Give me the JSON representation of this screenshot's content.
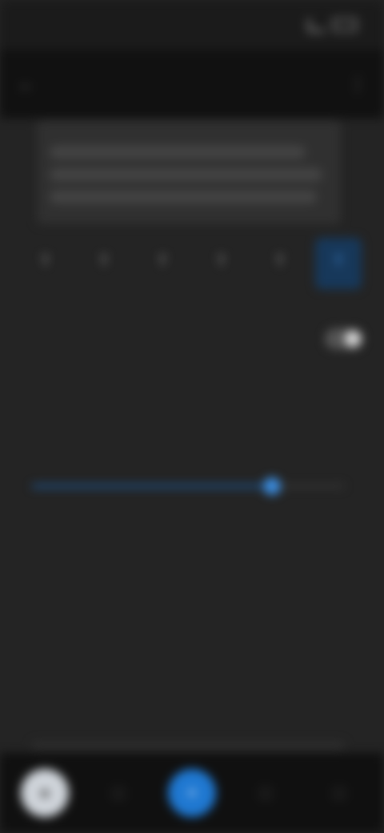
{
  "status_bar": {
    "time": "",
    "battery": ""
  },
  "app_bar": {
    "title": "",
    "back_icon": "arrow-left-icon",
    "menu_icon": "more-vertical-icon"
  },
  "preview": {
    "heading": "",
    "lines": [
      "",
      "",
      ""
    ]
  },
  "tabs": [
    {
      "label": "",
      "icon": "text-icon"
    },
    {
      "label": "",
      "icon": "text-icon"
    },
    {
      "label": "",
      "icon": "text-icon"
    },
    {
      "label": "",
      "icon": "text-icon"
    },
    {
      "label": "",
      "icon": "text-icon"
    },
    {
      "label": "",
      "icon": "text-icon",
      "active": true
    }
  ],
  "setting": {
    "label": "",
    "toggle_on": true
  },
  "slider": {
    "label": "",
    "value_fraction": 0.77
  },
  "bottom_nav": [
    {
      "icon": "avatar-icon"
    },
    {
      "icon": "nav-icon"
    },
    {
      "icon": "add-icon"
    },
    {
      "icon": "nav-icon"
    },
    {
      "icon": "nav-icon"
    }
  ],
  "colors": {
    "accent": "#1f78d1",
    "background": "#242424"
  }
}
